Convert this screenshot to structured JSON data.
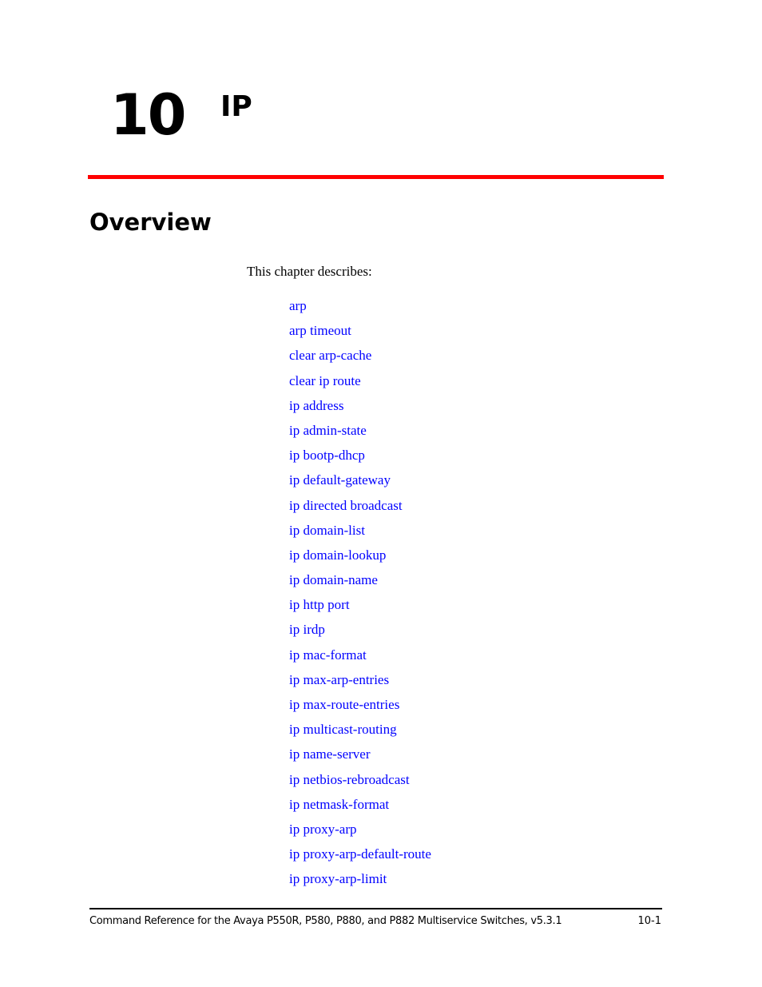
{
  "chapter": {
    "number": "10",
    "title": "IP"
  },
  "section": {
    "heading": "Overview",
    "intro": "This chapter describes:"
  },
  "links": [
    "arp",
    "arp timeout",
    "clear arp-cache",
    "clear ip route",
    "ip address",
    "ip admin-state",
    "ip bootp-dhcp",
    "ip default-gateway",
    "ip directed broadcast",
    "ip domain-list",
    "ip domain-lookup",
    "ip domain-name",
    "ip http port",
    "ip irdp",
    "ip mac-format",
    "ip max-arp-entries",
    "ip max-route-entries",
    "ip multicast-routing",
    "ip name-server",
    "ip netbios-rebroadcast",
    "ip netmask-format",
    "ip proxy-arp",
    "ip proxy-arp-default-route",
    "ip proxy-arp-limit"
  ],
  "footer": {
    "document_title": "Command Reference for the Avaya P550R, P580, P880, and P882 Multiservice Switches, v5.3.1",
    "page_number": "10-1"
  },
  "colors": {
    "rule": "#ff0000",
    "link": "#0000ff"
  }
}
